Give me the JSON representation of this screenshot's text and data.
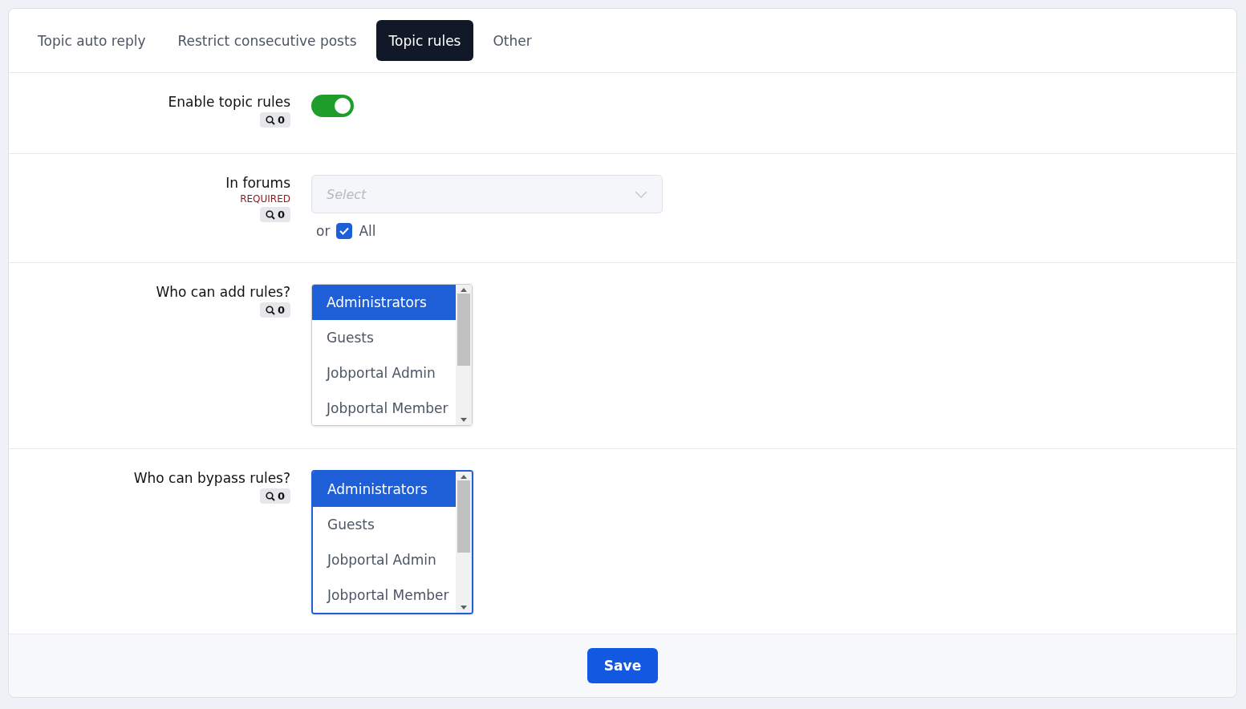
{
  "tabs": [
    {
      "label": "Topic auto reply",
      "selected": false
    },
    {
      "label": "Restrict consecutive posts",
      "selected": false
    },
    {
      "label": "Topic rules",
      "selected": true
    },
    {
      "label": "Other",
      "selected": false
    }
  ],
  "settings": [
    {
      "kind": "toggle",
      "label": "Enable topic rules",
      "search_count": "0",
      "on": true
    },
    {
      "kind": "select",
      "label": "In forums",
      "required": "REQUIRED",
      "search_count": "0",
      "placeholder": "Select",
      "or_label": "or",
      "all": {
        "label": "All",
        "checked": true
      }
    },
    {
      "kind": "listbox",
      "label": "Who can add rules?",
      "search_count": "0",
      "focused": false,
      "options": [
        {
          "label": "Administrators",
          "selected": true
        },
        {
          "label": "Guests",
          "selected": false
        },
        {
          "label": "Jobportal Admin",
          "selected": false
        },
        {
          "label": "Jobportal Member",
          "selected": false
        }
      ]
    },
    {
      "kind": "listbox",
      "label": "Who can bypass rules?",
      "search_count": "0",
      "focused": true,
      "options": [
        {
          "label": "Administrators",
          "selected": true
        },
        {
          "label": "Guests",
          "selected": false
        },
        {
          "label": "Jobportal Admin",
          "selected": false
        },
        {
          "label": "Jobportal Member",
          "selected": false
        }
      ]
    }
  ],
  "save_button": "Save"
}
